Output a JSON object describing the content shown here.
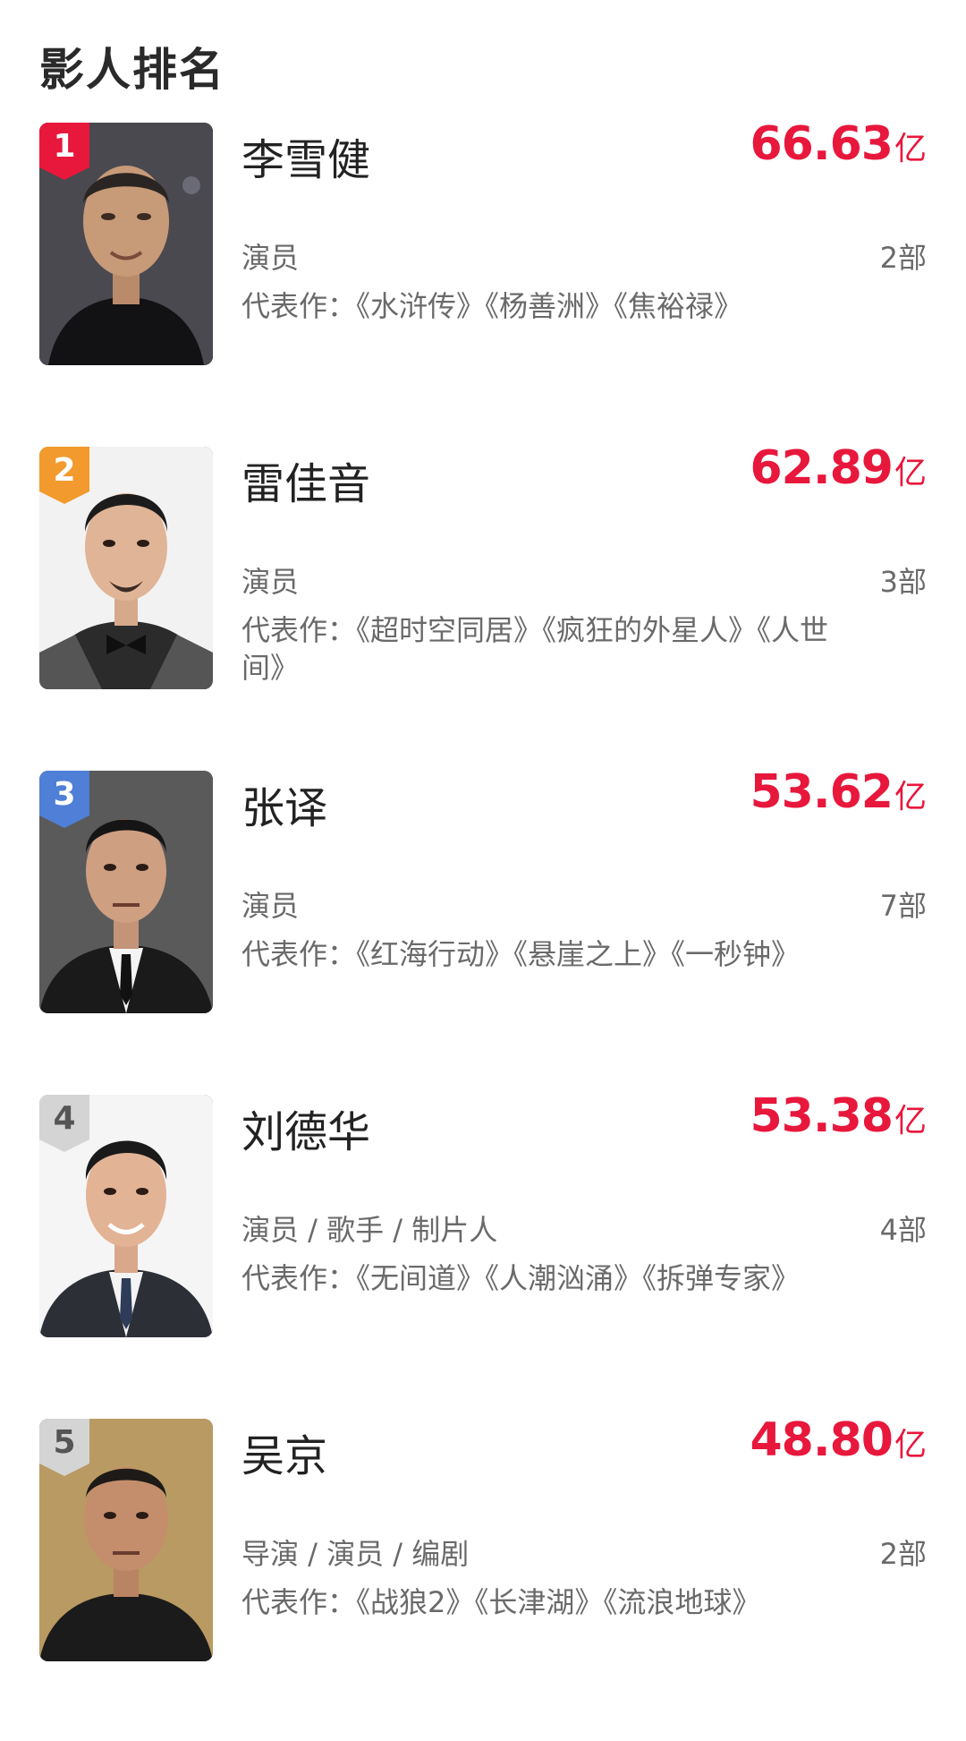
{
  "page": {
    "title": "影人排名"
  },
  "accent_color": "#e8173c",
  "people": [
    {
      "rank": "1",
      "name": "李雪健",
      "box_office_value": "66.63",
      "box_office_unit": "亿",
      "roles": "演员",
      "count": "2部",
      "works": "代表作：《水浒传》《杨善洲》《焦裕禄》",
      "badge_color": "#e8173c"
    },
    {
      "rank": "2",
      "name": "雷佳音",
      "box_office_value": "62.89",
      "box_office_unit": "亿",
      "roles": "演员",
      "count": "3部",
      "works": "代表作：《超时空同居》《疯狂的外星人》《人世间》",
      "badge_color": "#f29a2e"
    },
    {
      "rank": "3",
      "name": "张译",
      "box_office_value": "53.62",
      "box_office_unit": "亿",
      "roles": "演员",
      "count": "7部",
      "works": "代表作：《红海行动》《悬崖之上》《一秒钟》",
      "badge_color": "#4f7fd6"
    },
    {
      "rank": "4",
      "name": "刘德华",
      "box_office_value": "53.38",
      "box_office_unit": "亿",
      "roles": "演员 / 歌手 / 制片人",
      "count": "4部",
      "works": "代表作：《无间道》《人潮汹涌》《拆弹专家》",
      "badge_color": "#a9a9a9"
    },
    {
      "rank": "5",
      "name": "吴京",
      "box_office_value": "48.80",
      "box_office_unit": "亿",
      "roles": "导演 / 演员 / 编剧",
      "count": "2部",
      "works": "代表作：《战狼2》《长津湖》《流浪地球》",
      "badge_color": "#a9a9a9"
    }
  ]
}
